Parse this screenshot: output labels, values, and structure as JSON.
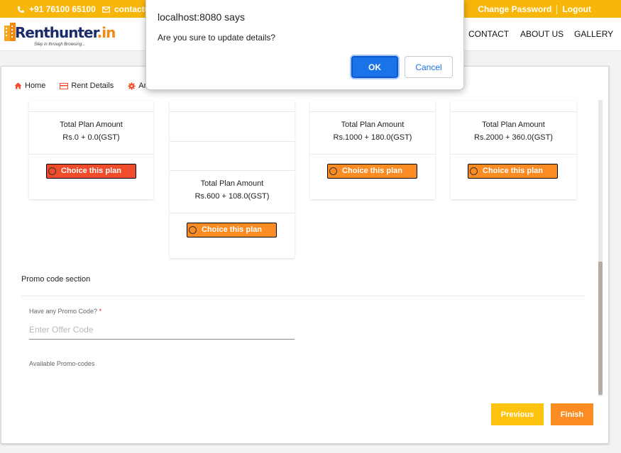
{
  "topbar": {
    "phone": "+91 76100 65100",
    "email": "contactu",
    "change_password": "Change Password",
    "logout": "Logout"
  },
  "header": {
    "logo_text": "Renthunter",
    "logo_suffix": ".in",
    "logo_tagline": "Step in through Browsing...",
    "nav": [
      "CONTACT",
      "ABOUT US",
      "GALLERY"
    ]
  },
  "breadcrumbs": [
    {
      "label": "Home",
      "icon": "home-icon"
    },
    {
      "label": "Rent Details",
      "icon": "card-icon"
    },
    {
      "label": "Am",
      "icon": "gear-icon"
    }
  ],
  "plans": [
    {
      "amount_label": "Total Plan Amount",
      "amount": "Rs.0 + 0.0(GST)",
      "button": "Choice this plan",
      "color": "#f04b2b"
    },
    {
      "amount_label": "Total Plan Amount",
      "amount": "Rs.600 + 108.0(GST)",
      "button": "Choice this plan",
      "color": "#fb8b23"
    },
    {
      "amount_label": "Total Plan Amount",
      "amount": "Rs.1000 + 180.0(GST)",
      "button": "Choice this plan",
      "color": "#fb8b23"
    },
    {
      "amount_label": "Total Plan Amount",
      "amount": "Rs.2000 + 360.0(GST)",
      "button": "Choice this plan",
      "color": "#fb8b23"
    }
  ],
  "promo": {
    "section_title": "Promo code section",
    "question": "Have any Promo Code?",
    "required_mark": "*",
    "placeholder": "Enter Offer Code",
    "value": "",
    "available_label": "Available Promo-codes"
  },
  "actions": {
    "previous": "Previous",
    "finish": "Finish"
  },
  "dialog": {
    "title": "localhost:8080 says",
    "message": "Are you sure to update details?",
    "ok": "OK",
    "cancel": "Cancel"
  },
  "colors": {
    "brand_yellow": "#f9b60a",
    "brand_orange": "#fb8b23",
    "selected_red": "#f04b2b",
    "dialog_blue": "#1a73e8"
  }
}
